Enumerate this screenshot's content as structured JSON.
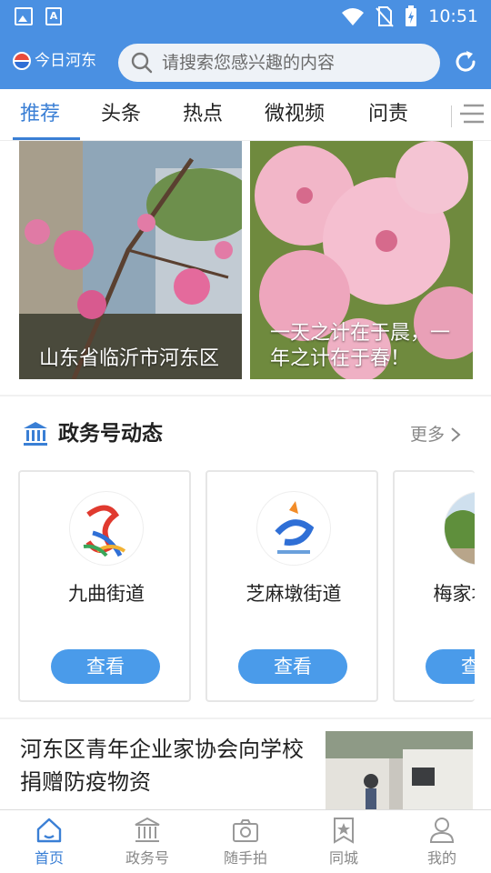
{
  "status_bar": {
    "time": "10:51",
    "icons": [
      "image-icon",
      "a-notification-icon",
      "wifi-icon",
      "no-sim-icon",
      "battery-charging-icon"
    ]
  },
  "header": {
    "app_name": "今日河东",
    "search_placeholder": "请搜索您感兴趣的内容",
    "refresh_icon": "refresh-icon"
  },
  "tabs": [
    {
      "label": "推荐",
      "active": true
    },
    {
      "label": "头条",
      "active": false
    },
    {
      "label": "热点",
      "active": false
    },
    {
      "label": "微视频",
      "active": false
    },
    {
      "label": "问责",
      "active": false
    }
  ],
  "photos": [
    {
      "caption": "山东省临沂市河东区"
    },
    {
      "caption": "一天之计在于晨，一年之计在于春！"
    }
  ],
  "gov_section": {
    "title": "政务号动态",
    "more_label": "更多",
    "cards": [
      {
        "name": "九曲街道",
        "button": "查看"
      },
      {
        "name": "芝麻墩街道",
        "button": "查看"
      },
      {
        "name": "梅家埠街道",
        "button": "查看"
      }
    ]
  },
  "news": [
    {
      "title": "河东区青年企业家协会向学校捐赠防疫物资"
    }
  ],
  "bottom_nav": [
    {
      "label": "首页",
      "icon": "home-icon",
      "active": true
    },
    {
      "label": "政务号",
      "icon": "government-icon",
      "active": false
    },
    {
      "label": "随手拍",
      "icon": "camera-icon",
      "active": false
    },
    {
      "label": "同城",
      "icon": "star-bookmark-icon",
      "active": false
    },
    {
      "label": "我的",
      "icon": "user-icon",
      "active": false
    }
  ],
  "colors": {
    "brand_blue": "#4a90e2",
    "active_tab": "#3a7fd5",
    "button_blue": "#4a9bea"
  }
}
